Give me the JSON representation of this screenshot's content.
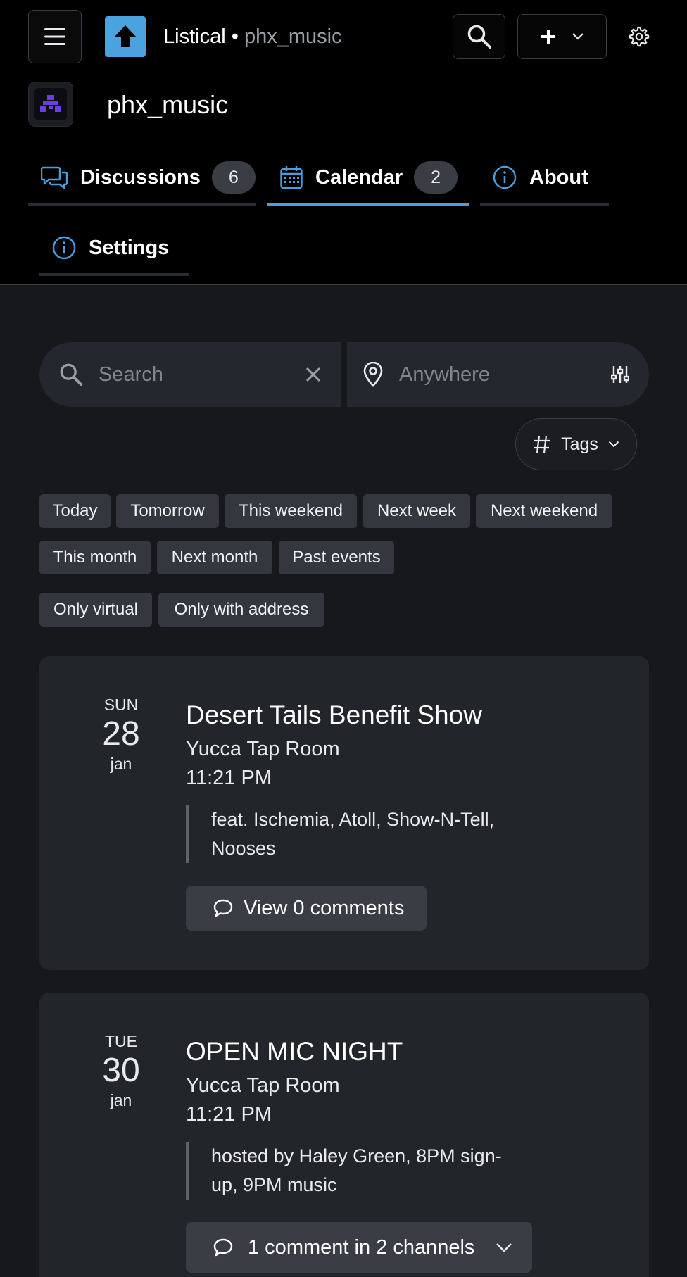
{
  "header": {
    "app_name": "Listical",
    "separator": "•",
    "forum_label": "phx_music"
  },
  "forum": {
    "name": "phx_music"
  },
  "tabs": [
    {
      "label": "Discussions",
      "count": "6"
    },
    {
      "label": "Calendar",
      "count": "2",
      "active": true
    },
    {
      "label": "About"
    },
    {
      "label": "Settings"
    }
  ],
  "filters": {
    "search_placeholder": "Search",
    "location_placeholder": "Anywhere",
    "tags_label": "Tags",
    "chips": [
      "Today",
      "Tomorrow",
      "This weekend",
      "Next week",
      "Next weekend",
      "This month",
      "Next month",
      "Past events",
      "Only virtual",
      "Only with address"
    ]
  },
  "events": [
    {
      "dow": "SUN",
      "day": "28",
      "month": "jan",
      "title": "Desert Tails Benefit Show",
      "place": "Yucca Tap Room",
      "time": "11:21 PM",
      "desc_line1": "feat. Ischemia, Atoll, Show-N-Tell,",
      "desc_line2": "Nooses",
      "comment_label": "View 0 comments"
    },
    {
      "dow": "TUE",
      "day": "30",
      "month": "jan",
      "title": "OPEN MIC NIGHT",
      "place": "Yucca Tap Room",
      "time": "11:21 PM",
      "desc_line1": "hosted by Haley Green, 8PM sign-",
      "desc_line2": "up, 9PM music",
      "comment_label": "1 comment in 2 channels"
    }
  ],
  "colors": {
    "accent": "#4a9ee0",
    "logo_bg": "#4aa3df",
    "avatar_glyph": "#6b3fe0"
  },
  "icons": [
    "menu-icon",
    "upload-arrow-icon",
    "search-icon",
    "plus-icon",
    "chevron-down-icon",
    "gear-icon",
    "chat-bubbles-icon",
    "calendar-icon",
    "info-icon",
    "close-icon",
    "map-pin-icon",
    "sliders-icon",
    "hash-icon",
    "comment-icon"
  ]
}
